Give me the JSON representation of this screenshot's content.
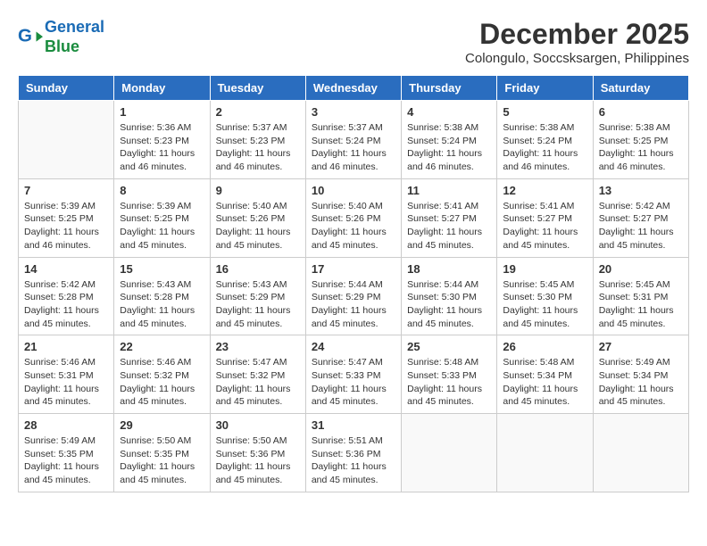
{
  "header": {
    "logo_line1": "General",
    "logo_line2": "Blue",
    "month": "December 2025",
    "location": "Colongulo, Soccsksargen, Philippines"
  },
  "weekdays": [
    "Sunday",
    "Monday",
    "Tuesday",
    "Wednesday",
    "Thursday",
    "Friday",
    "Saturday"
  ],
  "weeks": [
    [
      {
        "day": null
      },
      {
        "day": 1,
        "sunrise": "5:36 AM",
        "sunset": "5:23 PM",
        "daylight": "11 hours and 46 minutes."
      },
      {
        "day": 2,
        "sunrise": "5:37 AM",
        "sunset": "5:23 PM",
        "daylight": "11 hours and 46 minutes."
      },
      {
        "day": 3,
        "sunrise": "5:37 AM",
        "sunset": "5:24 PM",
        "daylight": "11 hours and 46 minutes."
      },
      {
        "day": 4,
        "sunrise": "5:38 AM",
        "sunset": "5:24 PM",
        "daylight": "11 hours and 46 minutes."
      },
      {
        "day": 5,
        "sunrise": "5:38 AM",
        "sunset": "5:24 PM",
        "daylight": "11 hours and 46 minutes."
      },
      {
        "day": 6,
        "sunrise": "5:38 AM",
        "sunset": "5:25 PM",
        "daylight": "11 hours and 46 minutes."
      }
    ],
    [
      {
        "day": 7,
        "sunrise": "5:39 AM",
        "sunset": "5:25 PM",
        "daylight": "11 hours and 46 minutes."
      },
      {
        "day": 8,
        "sunrise": "5:39 AM",
        "sunset": "5:25 PM",
        "daylight": "11 hours and 45 minutes."
      },
      {
        "day": 9,
        "sunrise": "5:40 AM",
        "sunset": "5:26 PM",
        "daylight": "11 hours and 45 minutes."
      },
      {
        "day": 10,
        "sunrise": "5:40 AM",
        "sunset": "5:26 PM",
        "daylight": "11 hours and 45 minutes."
      },
      {
        "day": 11,
        "sunrise": "5:41 AM",
        "sunset": "5:27 PM",
        "daylight": "11 hours and 45 minutes."
      },
      {
        "day": 12,
        "sunrise": "5:41 AM",
        "sunset": "5:27 PM",
        "daylight": "11 hours and 45 minutes."
      },
      {
        "day": 13,
        "sunrise": "5:42 AM",
        "sunset": "5:27 PM",
        "daylight": "11 hours and 45 minutes."
      }
    ],
    [
      {
        "day": 14,
        "sunrise": "5:42 AM",
        "sunset": "5:28 PM",
        "daylight": "11 hours and 45 minutes."
      },
      {
        "day": 15,
        "sunrise": "5:43 AM",
        "sunset": "5:28 PM",
        "daylight": "11 hours and 45 minutes."
      },
      {
        "day": 16,
        "sunrise": "5:43 AM",
        "sunset": "5:29 PM",
        "daylight": "11 hours and 45 minutes."
      },
      {
        "day": 17,
        "sunrise": "5:44 AM",
        "sunset": "5:29 PM",
        "daylight": "11 hours and 45 minutes."
      },
      {
        "day": 18,
        "sunrise": "5:44 AM",
        "sunset": "5:30 PM",
        "daylight": "11 hours and 45 minutes."
      },
      {
        "day": 19,
        "sunrise": "5:45 AM",
        "sunset": "5:30 PM",
        "daylight": "11 hours and 45 minutes."
      },
      {
        "day": 20,
        "sunrise": "5:45 AM",
        "sunset": "5:31 PM",
        "daylight": "11 hours and 45 minutes."
      }
    ],
    [
      {
        "day": 21,
        "sunrise": "5:46 AM",
        "sunset": "5:31 PM",
        "daylight": "11 hours and 45 minutes."
      },
      {
        "day": 22,
        "sunrise": "5:46 AM",
        "sunset": "5:32 PM",
        "daylight": "11 hours and 45 minutes."
      },
      {
        "day": 23,
        "sunrise": "5:47 AM",
        "sunset": "5:32 PM",
        "daylight": "11 hours and 45 minutes."
      },
      {
        "day": 24,
        "sunrise": "5:47 AM",
        "sunset": "5:33 PM",
        "daylight": "11 hours and 45 minutes."
      },
      {
        "day": 25,
        "sunrise": "5:48 AM",
        "sunset": "5:33 PM",
        "daylight": "11 hours and 45 minutes."
      },
      {
        "day": 26,
        "sunrise": "5:48 AM",
        "sunset": "5:34 PM",
        "daylight": "11 hours and 45 minutes."
      },
      {
        "day": 27,
        "sunrise": "5:49 AM",
        "sunset": "5:34 PM",
        "daylight": "11 hours and 45 minutes."
      }
    ],
    [
      {
        "day": 28,
        "sunrise": "5:49 AM",
        "sunset": "5:35 PM",
        "daylight": "11 hours and 45 minutes."
      },
      {
        "day": 29,
        "sunrise": "5:50 AM",
        "sunset": "5:35 PM",
        "daylight": "11 hours and 45 minutes."
      },
      {
        "day": 30,
        "sunrise": "5:50 AM",
        "sunset": "5:36 PM",
        "daylight": "11 hours and 45 minutes."
      },
      {
        "day": 31,
        "sunrise": "5:51 AM",
        "sunset": "5:36 PM",
        "daylight": "11 hours and 45 minutes."
      },
      {
        "day": null
      },
      {
        "day": null
      },
      {
        "day": null
      }
    ]
  ],
  "labels": {
    "sunrise_prefix": "Sunrise: ",
    "sunset_prefix": "Sunset: ",
    "daylight_prefix": "Daylight: "
  }
}
